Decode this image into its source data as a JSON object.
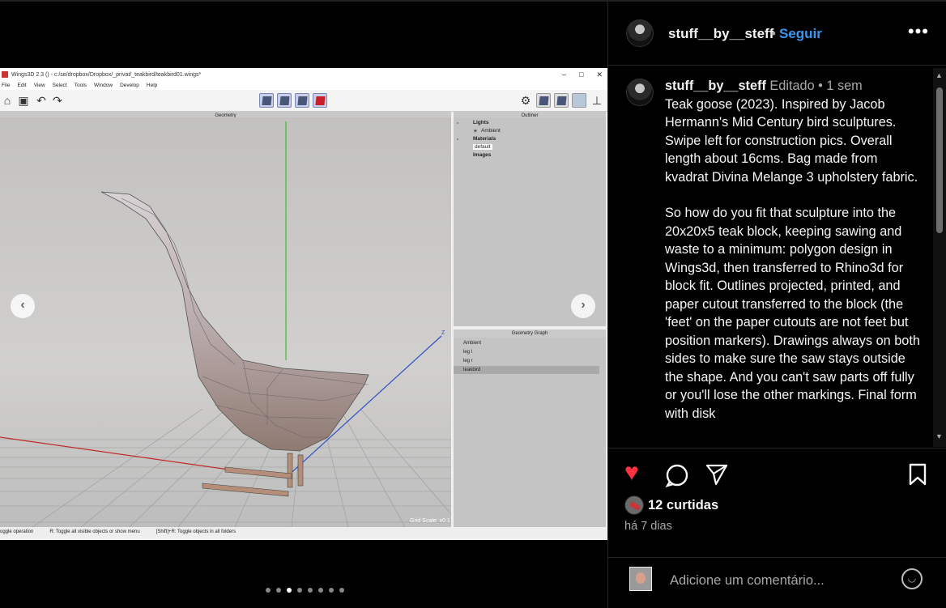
{
  "wings": {
    "title": "Wings3D 2.3 () - c:/se/dropbox/Dropbox/_privat/_teakbird/teakbird01.wings*",
    "menu": [
      "File",
      "Edit",
      "View",
      "Select",
      "Tools",
      "Window",
      "Develop",
      "Help"
    ],
    "geometry_title": "Geometry",
    "outliner_title": "Outliner",
    "outliner_items": {
      "lights": "Lights",
      "ambient": "Ambient",
      "materials": "Materials",
      "default": "default",
      "images": "Images"
    },
    "geograph_title": "Geometry Graph",
    "geograph_rows": [
      "Ambient",
      "leg l",
      "leg r",
      "teakbird"
    ],
    "grid_scale": "Grid Scale: x0.1",
    "axis_z": "Z",
    "status": [
      "oggle operation",
      "R: Toggle all visible objects or show menu",
      "[Shift]+R: Toggle objects in all folders"
    ]
  },
  "carousel": {
    "prev": "‹",
    "next": "›",
    "dots": 8,
    "active_dot": 2
  },
  "post": {
    "username": "stuff__by__steff",
    "follow_label": "Seguir",
    "more_label": "•••",
    "caption_user": "stuff__by__steff",
    "caption_meta": "Editado • 1 sem",
    "caption_p1": "Teak goose (2023). Inspired by Jacob Hermann's Mid Century bird sculptures. Swipe left for construction pics. Overall length about 16cms. Bag made from kvadrat Divina Melange 3 upholstery fabric.",
    "caption_p2": "So how do you fit that sculpture into the 20x20x5 teak block, keeping sawing and waste to a minimum: polygon design in Wings3d, then transferred to Rhino3d for block fit. Outlines projected, printed, and paper cutout transferred to the block (the 'feet' on the paper cutouts are not feet but position markers). Drawings always on both sides to make sure the saw stays outside the shape. And you can't saw parts off fully or you'll lose the other markings. Final form with disk",
    "likes": "12 curtidas",
    "time_ago": "há 7 dias",
    "comment_placeholder": "Adicione um comentário..."
  },
  "colors": {
    "accent": "#3897f0",
    "like": "#ff3040",
    "background": "#000000"
  }
}
